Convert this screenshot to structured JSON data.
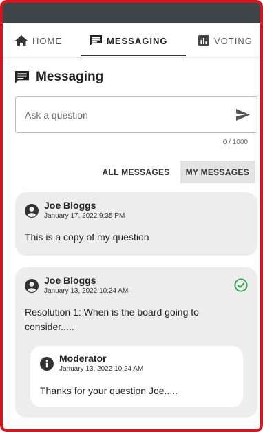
{
  "nav": {
    "tabs": [
      {
        "label": "HOME",
        "icon": "home-icon"
      },
      {
        "label": "MESSAGING",
        "icon": "message-icon",
        "active": true
      },
      {
        "label": "VOTING",
        "icon": "bar-chart-icon"
      }
    ]
  },
  "page": {
    "title": "Messaging"
  },
  "ask": {
    "placeholder": "Ask a question",
    "counter": "0 / 1000"
  },
  "filters": {
    "all": "ALL MESSAGES",
    "mine": "MY MESSAGES",
    "selected": "mine"
  },
  "messages": [
    {
      "author": "Joe Bloggs",
      "date": "January 17, 2022 9:35 PM",
      "text": "This is a copy of my question"
    },
    {
      "author": "Joe Bloggs",
      "date": "January 13, 2022 10:24 AM",
      "text": "Resolution 1: When is the board going to consider.....",
      "answered": true,
      "reply": {
        "author": "Moderator",
        "date": "January 13, 2022 10:24 AM",
        "text": "Thanks for your question Joe....."
      }
    }
  ],
  "colors": {
    "frame": "#d8131b",
    "topbar": "#3e4448",
    "check": "#2e9e4f",
    "card": "#ededed"
  }
}
